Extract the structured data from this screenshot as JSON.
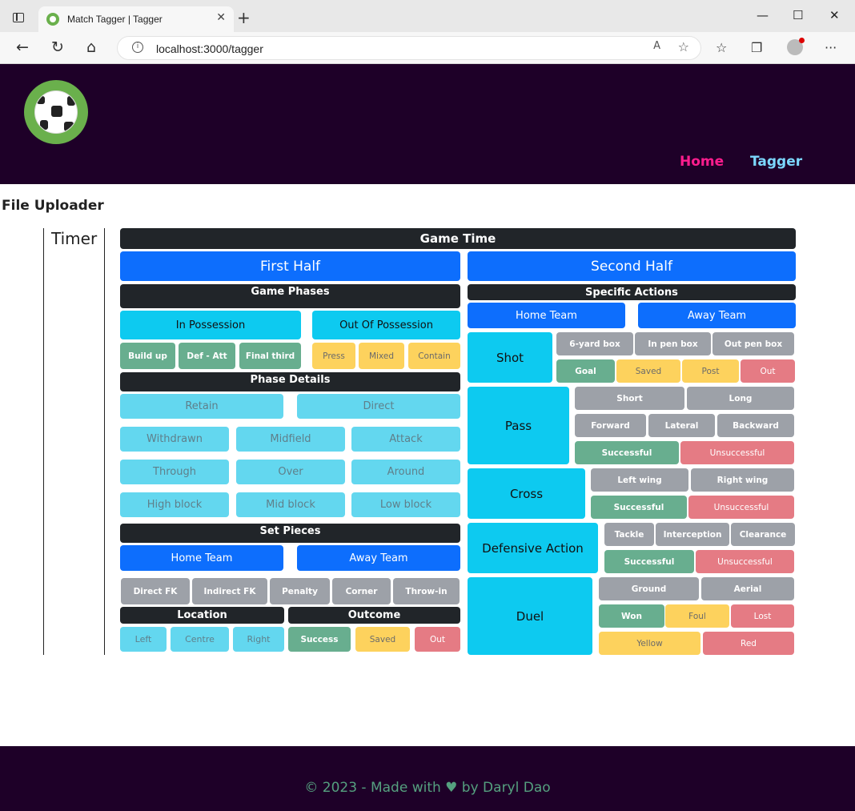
{
  "browser": {
    "tab_title": "Match Tagger | Tagger",
    "url": "localhost:3000/tagger",
    "tab_close": "✕",
    "new_tab": "+",
    "minimize": "—",
    "maximize": "☐",
    "close": "✕"
  },
  "nav": {
    "home": "Home",
    "tagger": "Tagger"
  },
  "page": {
    "file_uploader": "File Uploader",
    "timer": "Timer"
  },
  "game_time": {
    "title": "Game Time",
    "first_half": "First Half",
    "second_half": "Second Half"
  },
  "phases": {
    "title": "Game Phases",
    "in_possession": "In Possession",
    "out_of_possession": "Out Of Possession",
    "in_items": [
      "Build up",
      "Def - Att",
      "Final third"
    ],
    "out_items": [
      "Press",
      "Mixed",
      "Contain"
    ]
  },
  "phase_details": {
    "title": "Phase Details",
    "row1": [
      "Retain",
      "Direct"
    ],
    "row2": [
      "Withdrawn",
      "Midfield",
      "Attack"
    ],
    "row3": [
      "Through",
      "Over",
      "Around"
    ],
    "row4": [
      "High block",
      "Mid block",
      "Low block"
    ]
  },
  "set_pieces": {
    "title": "Set Pieces",
    "home_team": "Home Team",
    "away_team": "Away Team",
    "types": [
      "Direct FK",
      "Indirect FK",
      "Penalty",
      "Corner",
      "Throw-in"
    ]
  },
  "location": {
    "title": "Location",
    "items": [
      "Left",
      "Centre",
      "Right"
    ]
  },
  "outcome": {
    "title": "Outcome",
    "success": "Success",
    "saved": "Saved",
    "out": "Out"
  },
  "specific": {
    "title": "Specific Actions",
    "home_team": "Home Team",
    "away_team": "Away Team",
    "shot": {
      "label": "Shot",
      "zones": [
        "6-yard box",
        "In pen box",
        "Out pen box"
      ],
      "results": [
        "Goal",
        "Saved",
        "Post",
        "Out"
      ]
    },
    "pass": {
      "label": "Pass",
      "lengths": [
        "Short",
        "Long"
      ],
      "directions": [
        "Forward",
        "Lateral",
        "Backward"
      ],
      "results": [
        "Successful",
        "Unsuccessful"
      ]
    },
    "cross": {
      "label": "Cross",
      "sides": [
        "Left wing",
        "Right wing"
      ],
      "results": [
        "Successful",
        "Unsuccessful"
      ]
    },
    "defensive": {
      "label": "Defensive Action",
      "types": [
        "Tackle",
        "Interception",
        "Clearance"
      ],
      "results": [
        "Successful",
        "Unsuccessful"
      ]
    },
    "duel": {
      "label": "Duel",
      "types": [
        "Ground",
        "Aerial"
      ],
      "results": [
        "Won",
        "Foul",
        "Lost"
      ],
      "cards": [
        "Yellow",
        "Red"
      ]
    }
  },
  "footer": {
    "text": "© 2023 - Made with ♥ by Daryl Dao"
  }
}
